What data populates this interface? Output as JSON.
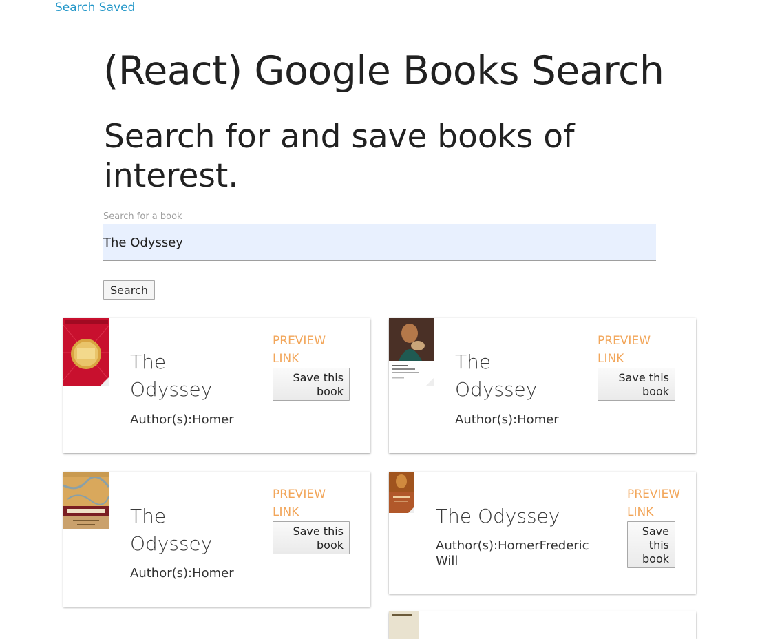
{
  "nav": {
    "search_saved_label": "Search Saved"
  },
  "header": {
    "title": "(React) Google Books Search",
    "subtitle": "Search for and save books of interest."
  },
  "search": {
    "label": "Search for a book",
    "value": "The Odyssey",
    "button_label": "Search"
  },
  "results": [
    {
      "title": "The Odyssey",
      "author_label": "Author(s):",
      "authors": "Homer",
      "preview_label": "PREVIEW LINK",
      "save_label": "Save this book",
      "cover": "red-classic-cover"
    },
    {
      "title": "The Odyssey",
      "author_label": "Author(s):",
      "authors": "Homer",
      "preview_label": "PREVIEW LINK",
      "save_label": "Save this book",
      "cover": "painting-cover"
    },
    {
      "title": "The Odyssey",
      "author_label": "Author(s):",
      "authors": "Homer",
      "preview_label": "PREVIEW LINK",
      "save_label": "Save this book",
      "cover": "map-cover"
    },
    {
      "title": "The Odyssey",
      "author_label": "Author(s):",
      "authors": "HomerFrederic Will",
      "preview_label": "PREVIEW LINK",
      "save_label": "Save this book",
      "cover": "orange-painting-cover"
    }
  ],
  "colors": {
    "link": "#2196c8",
    "preview": "#f2a65a",
    "input_bg": "#e8f0fe"
  }
}
